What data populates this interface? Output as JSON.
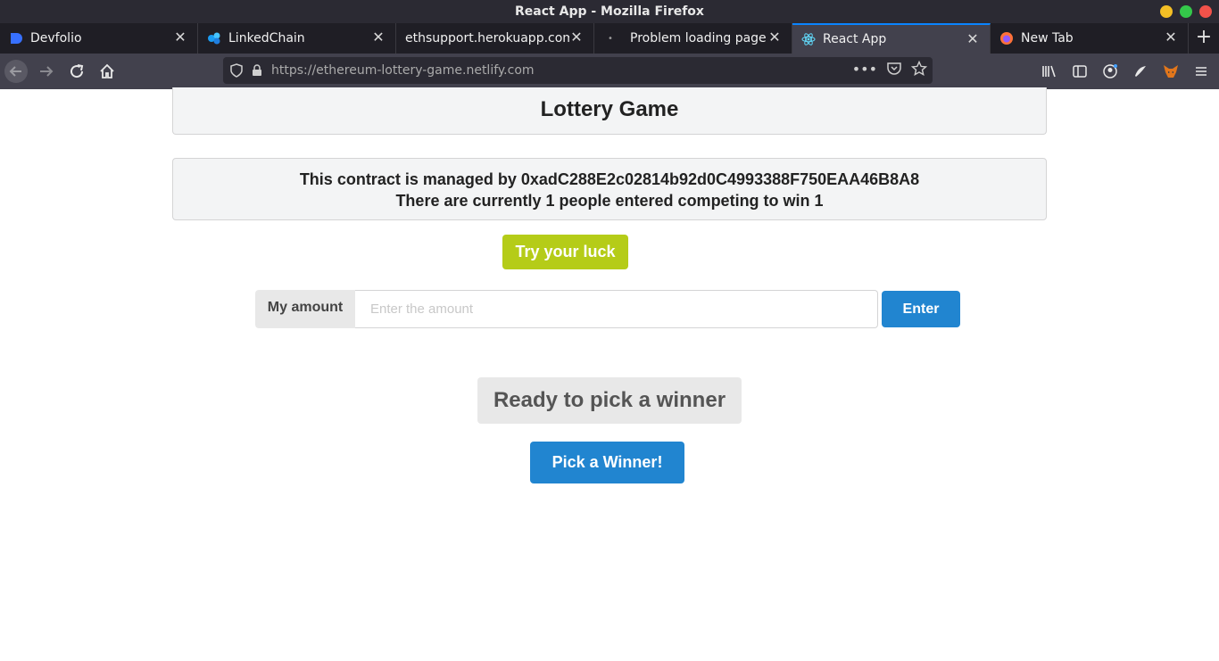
{
  "window": {
    "title": "React App - Mozilla Firefox"
  },
  "tabs": [
    {
      "label": "Devfolio",
      "icon": "devfolio-icon",
      "active": false
    },
    {
      "label": "LinkedChain",
      "icon": "linkedchain-icon",
      "active": false
    },
    {
      "label": "ethsupport.herokuapp.com/",
      "icon": "none",
      "active": false
    },
    {
      "label": "Problem loading page",
      "icon": "dot-icon",
      "active": false
    },
    {
      "label": "React App",
      "icon": "react-icon",
      "active": true
    },
    {
      "label": "New Tab",
      "icon": "firefox-icon",
      "active": false
    }
  ],
  "navbar": {
    "url": "https://ethereum-lottery-game.netlify.com"
  },
  "page": {
    "title": "Lottery Game",
    "manager_text": "This contract is managed by 0xadC288E2c02814b92d0C4993388F750EAA46B8A8",
    "players_text": "There are currently 1 people entered competing to win 1",
    "luck_button": "Try your luck",
    "amount_label": "My amount",
    "amount_placeholder": "Enter the amount",
    "enter_button": "Enter",
    "ready_label": "Ready to pick a winner",
    "pick_button": "Pick a Winner!"
  },
  "colors": {
    "olive": "#b5cc18",
    "blue": "#2185d0",
    "tab_accent": "#0a84ff"
  }
}
